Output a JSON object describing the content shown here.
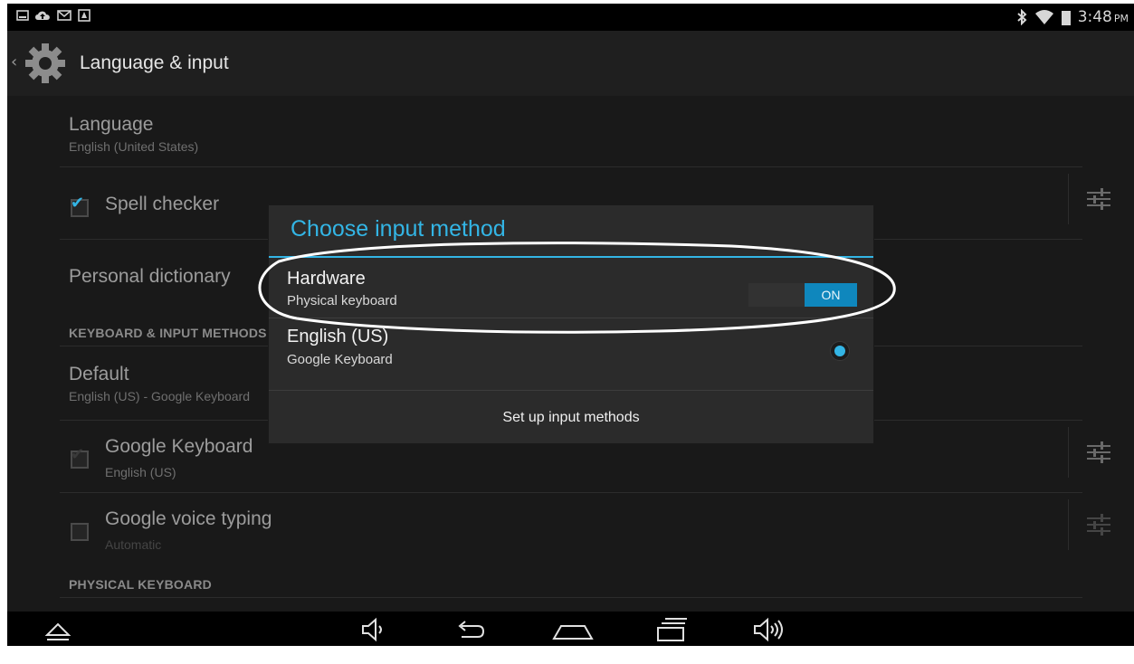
{
  "status_bar": {
    "time": "3:48",
    "ampm": "PM",
    "left_icons": [
      "screenshot-icon",
      "cloud-upload-icon",
      "gmail-icon",
      "notification-icon"
    ],
    "right_icons": [
      "bluetooth-icon",
      "wifi-icon",
      "battery-icon"
    ]
  },
  "action_bar": {
    "title": "Language & input"
  },
  "settings": {
    "language": {
      "title": "Language",
      "subtitle": "English (United States)"
    },
    "spell_checker": {
      "title": "Spell checker",
      "checked": true
    },
    "personal_dictionary": {
      "title": "Personal dictionary"
    },
    "keyboard_section_header": "KEYBOARD & INPUT METHODS",
    "default": {
      "title": "Default",
      "subtitle": "English (US) - Google Keyboard"
    },
    "google_keyboard": {
      "title": "Google Keyboard",
      "subtitle": "English (US)",
      "checked": true
    },
    "google_voice_typing": {
      "title": "Google voice typing",
      "subtitle": "Automatic",
      "checked": false
    },
    "physical_keyboard_section_header": "PHYSICAL KEYBOARD"
  },
  "dialog": {
    "title": "Choose input method",
    "hardware": {
      "title": "Hardware",
      "subtitle": "Physical keyboard",
      "toggle_label": "ON"
    },
    "english": {
      "title": "English (US)",
      "subtitle": "Google Keyboard",
      "selected": true
    },
    "setup_label": "Set up input methods"
  },
  "nav_bar": {
    "buttons": [
      "menu-up-icon",
      "volume-down-icon",
      "back-icon",
      "home-icon",
      "recents-icon",
      "volume-up-icon"
    ]
  },
  "colors": {
    "accent": "#33b5e5",
    "toggle_on": "#0f87bd",
    "background": "#151515"
  }
}
